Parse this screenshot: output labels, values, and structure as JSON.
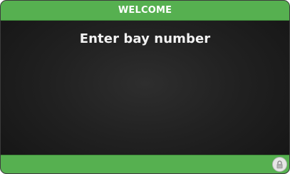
{
  "header": {
    "title": "WELCOME"
  },
  "main": {
    "prompt": "Enter bay number"
  },
  "footer": {
    "lock_icon": "lock-icon"
  },
  "colors": {
    "accent_green": "#56b050",
    "background": "#1e1e1e",
    "text": "#f2f2f2"
  }
}
